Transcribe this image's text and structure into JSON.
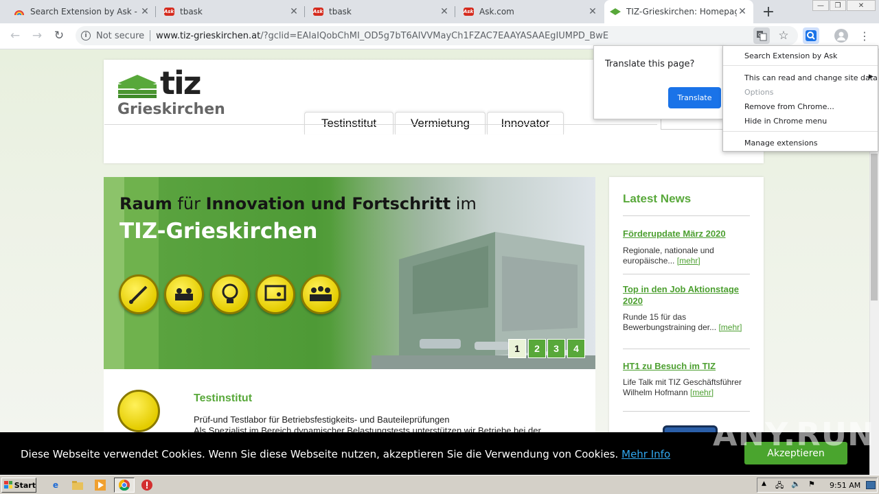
{
  "browser": {
    "tabs": [
      {
        "title": "Search Extension by Ask - Chrom",
        "icon": "rainbow-icon"
      },
      {
        "title": "tbask",
        "icon": "ask-icon"
      },
      {
        "title": "tbask",
        "icon": "ask-icon"
      },
      {
        "title": "Ask.com",
        "icon": "ask-icon"
      },
      {
        "title": "TIZ-Grieskirchen: Homepage",
        "icon": "tiz-icon"
      }
    ],
    "new_tab_label": "+",
    "security_label": "Not secure",
    "url_host": "www.tiz-grieskirchen.at",
    "url_rest": "/?gclid=EAIaIQobChMI_OD5g7bT6AIVVMayCh1FZAC7EAAYASAAEgIUMPD_BwE",
    "ask_badge": "Ask"
  },
  "page": {
    "logo_main": "tiz",
    "logo_sub": "Grieskirchen",
    "nav": [
      "Testinstitut",
      "Vermietung",
      "Innovator"
    ],
    "slider": {
      "title_a": "Raum",
      "title_b": " für ",
      "title_c": "Innovation und Fortschritt",
      "title_d": " im",
      "title_line2": "TIZ-Grieskirchen",
      "pages": [
        "1",
        "2",
        "3",
        "4"
      ],
      "active_page": 1
    },
    "teaser": {
      "title": "Testinstitut",
      "subtitle": "Prüf-und Testlabor für Betriebsfestigkeits- und Bauteileprüfungen",
      "text": "Als Spezialist im Bereich dynamischer Belastungstests unterstützen wir Betriebe bei der"
    },
    "news": {
      "heading": "Latest News",
      "more": "[mehr]",
      "items": [
        {
          "title": "Förderupdate März 2020",
          "text": "Regionale, nationale und europäische..."
        },
        {
          "title": "Top in den Job Aktionstage 2020",
          "text": "Runde 15 für das Bewerbungstraining der..."
        },
        {
          "title": "HT1 zu Besuch im TIZ",
          "text": "Life Talk mit TIZ Geschäftsführer Wilhelm Hofmann"
        }
      ]
    }
  },
  "translate_popup": {
    "question": "Translate this page?",
    "button": "Translate"
  },
  "extension_menu": {
    "items": [
      {
        "label": "Search Extension by Ask",
        "enabled": true
      },
      {
        "label": "This can read and change site data",
        "enabled": true
      },
      {
        "label": "Options",
        "enabled": false
      },
      {
        "label": "Remove from Chrome...",
        "enabled": true
      },
      {
        "label": "Hide in Chrome menu",
        "enabled": true
      },
      {
        "label": "Manage extensions",
        "enabled": true
      }
    ]
  },
  "cookie_bar": {
    "text": "Diese Webseite verwendet Cookies. Wenn Sie diese Webseite nutzen, akzeptieren Sie die Verwendung von Cookies.",
    "link": "Mehr Info",
    "accept": "Akzeptieren"
  },
  "watermark": "ANY.RUN",
  "taskbar": {
    "start": "Start",
    "clock": "9:51 AM"
  },
  "colors": {
    "brand_green": "#58a83a",
    "chrome_blue": "#1a73e8",
    "ask_red": "#d52b1e"
  }
}
